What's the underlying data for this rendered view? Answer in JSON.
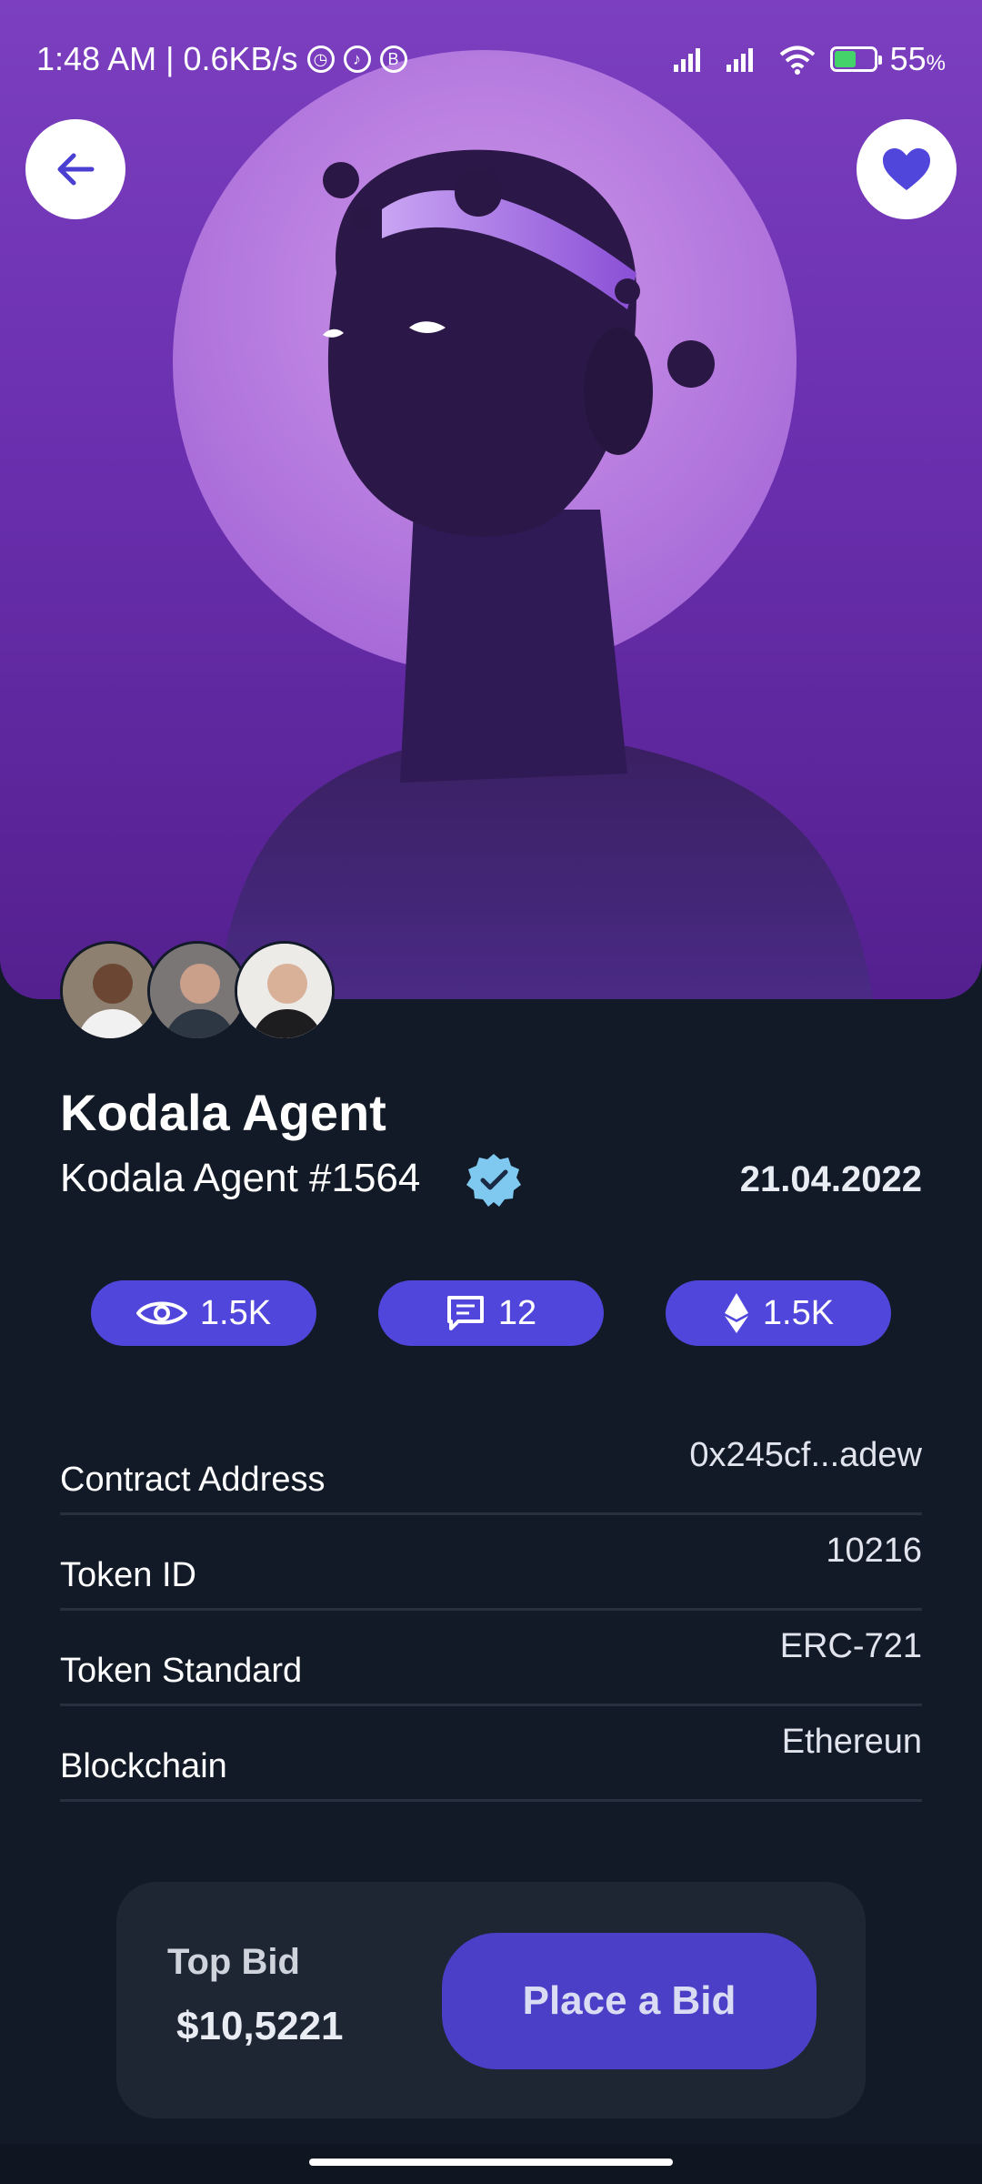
{
  "status_bar": {
    "time_net": "1:48 AM | 0.6KB/s",
    "battery": "55",
    "battery_unit": "%",
    "battery_level": 0.55
  },
  "nav": {
    "back_icon": "arrow-left-icon",
    "favorite_icon": "heart-icon"
  },
  "colors": {
    "accent": "#5046dc",
    "background": "#121a28",
    "card": "#1e2634",
    "verified": "#7fc8ef"
  },
  "nft": {
    "title": "Kodala Agent",
    "subtitle": "Kodala Agent #1564",
    "date": "21.04.2022"
  },
  "stats": [
    {
      "icon": "eye-icon",
      "value": "1.5K"
    },
    {
      "icon": "comment-icon",
      "value": "12"
    },
    {
      "icon": "ethereum-icon",
      "value": "1.5K"
    }
  ],
  "details": [
    {
      "label": "Contract Address",
      "value": "0x245cf...adew"
    },
    {
      "label": "Token ID",
      "value": "10216"
    },
    {
      "label": "Token Standard",
      "value": "ERC-721"
    },
    {
      "label": "Blockchain",
      "value": "Ethereun"
    }
  ],
  "bid": {
    "label": "Top Bid",
    "amount": "$10,5221",
    "button": "Place a Bid"
  }
}
